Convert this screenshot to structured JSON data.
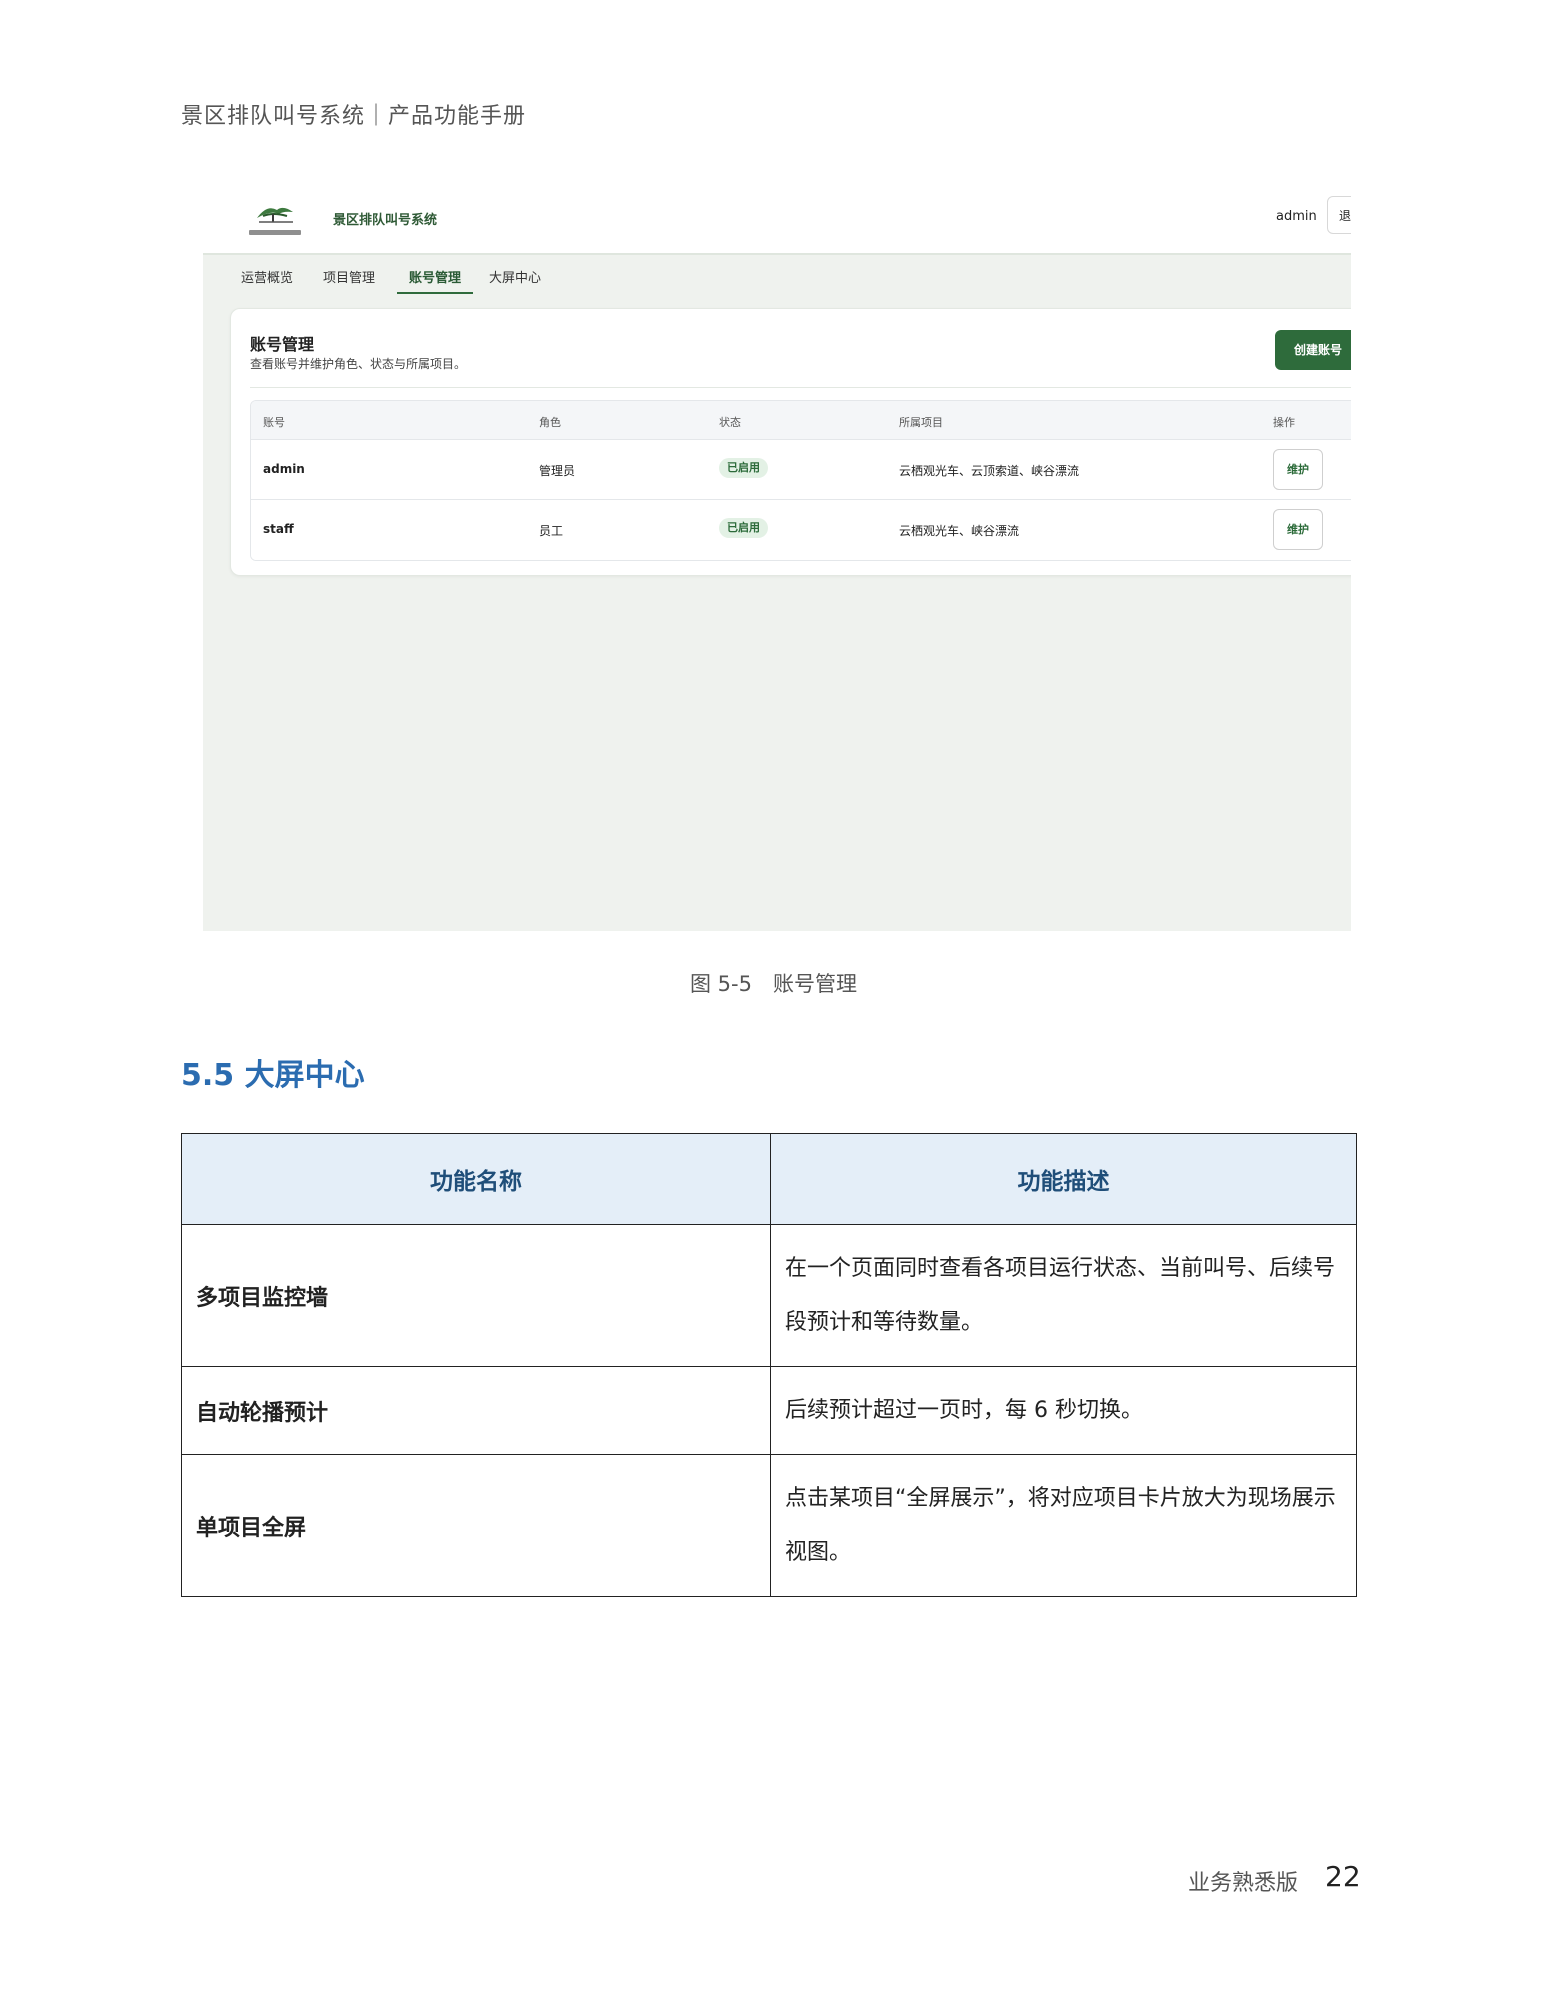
{
  "header": {
    "running_title": "景区排队叫号系统｜产品功能手册"
  },
  "screenshot": {
    "app_title": "景区排队叫号系统",
    "user": "admin",
    "logout_label": "退",
    "tabs": [
      {
        "label": "运营概览",
        "active": false
      },
      {
        "label": "项目管理",
        "active": false
      },
      {
        "label": "账号管理",
        "active": true
      },
      {
        "label": "大屏中心",
        "active": false
      }
    ],
    "card": {
      "title": "账号管理",
      "subtitle": "查看账号并维护角色、状态与所属项目。",
      "create_button": "创建账号",
      "columns": [
        "账号",
        "角色",
        "状态",
        "所属项目",
        "操作"
      ],
      "rows": [
        {
          "account": "admin",
          "role": "管理员",
          "status": "已启用",
          "projects": "云栖观光车、云顶索道、峡谷漂流",
          "action": "维护"
        },
        {
          "account": "staff",
          "role": "员工",
          "status": "已启用",
          "projects": "云栖观光车、峡谷漂流",
          "action": "维护"
        }
      ]
    },
    "accent_color": "#2e6b3b",
    "logo_icon": "tree-logo-icon"
  },
  "caption": "图 5-5　账号管理",
  "section": {
    "title": "5.5 大屏中心"
  },
  "feature_table": {
    "headers": [
      "功能名称",
      "功能描述"
    ],
    "rows": [
      {
        "name": "多项目监控墙",
        "desc": "在一个页面同时查看各项目运行状态、当前叫号、后续号段预计和等待数量。"
      },
      {
        "name": "自动轮播预计",
        "desc": "后续预计超过一页时，每 6 秒切换。"
      },
      {
        "name": "单项目全屏",
        "desc": "点击某项目“全屏展示”，将对应项目卡片放大为现场展示视图。"
      }
    ]
  },
  "footer": {
    "label": "业务熟悉版",
    "page": "22"
  }
}
